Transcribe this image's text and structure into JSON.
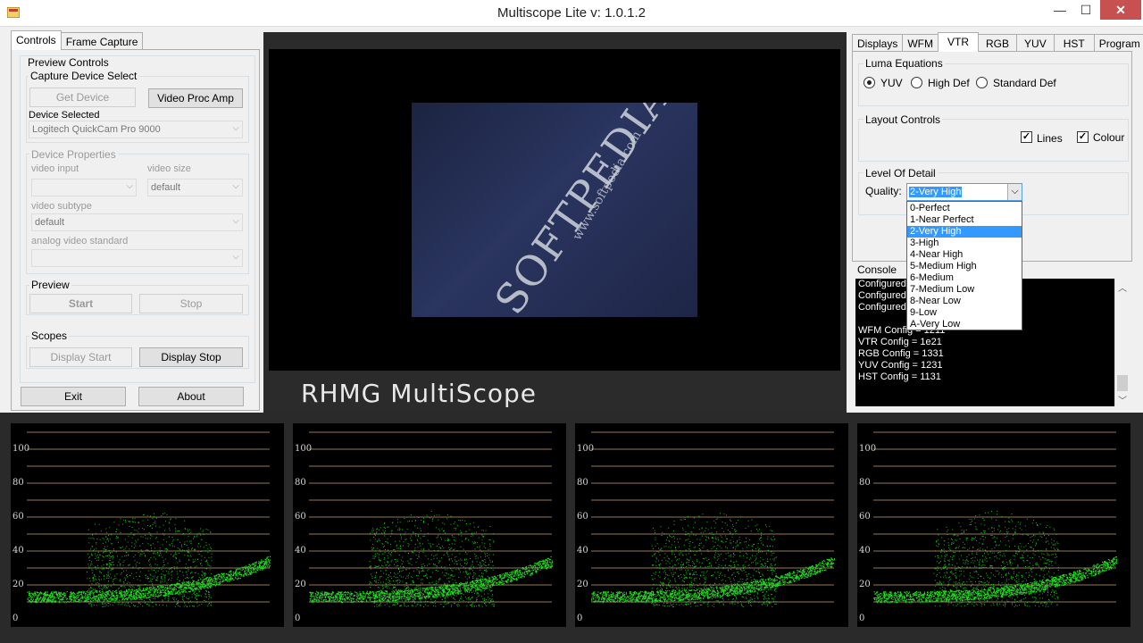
{
  "window": {
    "title": "Multiscope Lite v: 1.0.1.2",
    "minimize": "—",
    "maximize": "☐",
    "close": "✕"
  },
  "left_tabs": [
    "Controls",
    "Frame Capture"
  ],
  "preview_controls": {
    "title": "Preview Controls",
    "capture_device_select": "Capture Device Select",
    "get_device": "Get Device",
    "video_proc_amp": "Video Proc Amp",
    "device_selected_label": "Device Selected",
    "device_selected_value": "Logitech QuickCam Pro 9000",
    "device_properties": "Device Properties",
    "video_input_label": "video input",
    "video_input_value": "",
    "video_size_label": "video size",
    "video_size_value": "default",
    "video_subtype_label": "video subtype",
    "video_subtype_value": "default",
    "analog_label": "analog video standard",
    "analog_value": "",
    "preview_title": "Preview",
    "start": "Start",
    "stop": "Stop",
    "scopes_title": "Scopes",
    "display_start": "Display Start",
    "display_stop": "Display Stop",
    "exit": "Exit",
    "about": "About"
  },
  "video": {
    "caption": "RHMG MultiScope",
    "watermark_main": "SOFTPEDIA",
    "watermark_url": "www.softpedia.com"
  },
  "right_tabs": [
    "Displays",
    "WFM",
    "VTR",
    "RGB",
    "YUV",
    "HST",
    "Program"
  ],
  "vtr": {
    "luma_title": "Luma Equations",
    "luma_options": [
      "YUV",
      "High Def",
      "Standard Def"
    ],
    "luma_selected": "YUV",
    "layout_title": "Layout Controls",
    "lines_label": "Lines",
    "colour_label": "Colour",
    "lines_checked": "✓",
    "colour_checked": "✓",
    "detail_title": "Level Of Detail",
    "quality_label": "Quality:",
    "quality_value": "2-Very High",
    "quality_options": [
      "0-Perfect",
      "1-Near Perfect",
      "2-Very High",
      "3-High",
      "4-Near High",
      "5-Medium High",
      "6-Medium",
      "7-Medium Low",
      "8-Near Low",
      "9-Low",
      "A-Very Low"
    ]
  },
  "console": {
    "title": "Console",
    "lines": [
      "Configured",
      "Configured",
      "Configured",
      "",
      "WFM Config = 1211",
      "VTR Config = 1e21",
      "RGB Config = 1331",
      "YUV Config = 1231",
      "HST Config = 1131"
    ]
  },
  "scope_axis": [
    "100",
    "80",
    "60",
    "40",
    "20",
    "0"
  ],
  "colors": {
    "trace": "#22dd22",
    "grid": "#c8a070"
  }
}
